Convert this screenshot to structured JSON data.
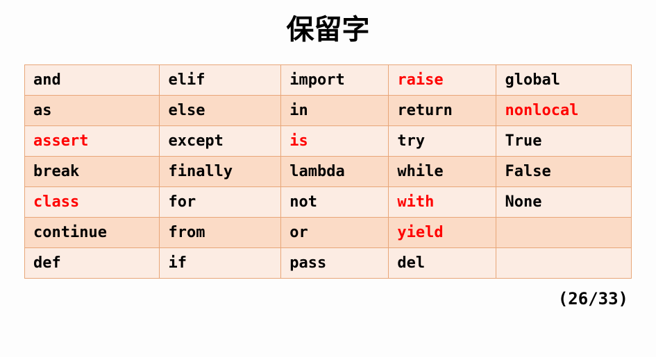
{
  "title": "保留字",
  "page_indicator": "(26/33)",
  "columns": 5,
  "table": {
    "rows": [
      [
        {
          "text": "and",
          "highlight": false
        },
        {
          "text": "elif",
          "highlight": false
        },
        {
          "text": "import",
          "highlight": false
        },
        {
          "text": "raise",
          "highlight": true
        },
        {
          "text": "global",
          "highlight": false
        }
      ],
      [
        {
          "text": "as",
          "highlight": false
        },
        {
          "text": "else",
          "highlight": false
        },
        {
          "text": "in",
          "highlight": false
        },
        {
          "text": "return",
          "highlight": false
        },
        {
          "text": "nonlocal",
          "highlight": true
        }
      ],
      [
        {
          "text": "assert",
          "highlight": true
        },
        {
          "text": "except",
          "highlight": false
        },
        {
          "text": "is",
          "highlight": true
        },
        {
          "text": "try",
          "highlight": false
        },
        {
          "text": "True",
          "highlight": false
        }
      ],
      [
        {
          "text": "break",
          "highlight": false
        },
        {
          "text": "finally",
          "highlight": false
        },
        {
          "text": "lambda",
          "highlight": false
        },
        {
          "text": "while",
          "highlight": false
        },
        {
          "text": "False",
          "highlight": false
        }
      ],
      [
        {
          "text": "class",
          "highlight": true
        },
        {
          "text": "for",
          "highlight": false
        },
        {
          "text": "not",
          "highlight": false
        },
        {
          "text": "with",
          "highlight": true
        },
        {
          "text": "None",
          "highlight": false
        }
      ],
      [
        {
          "text": "continue",
          "highlight": false
        },
        {
          "text": "from",
          "highlight": false
        },
        {
          "text": "or",
          "highlight": false
        },
        {
          "text": "yield",
          "highlight": true
        },
        {
          "text": "",
          "highlight": false
        }
      ],
      [
        {
          "text": "def",
          "highlight": false
        },
        {
          "text": "if",
          "highlight": false
        },
        {
          "text": "pass",
          "highlight": false
        },
        {
          "text": "del",
          "highlight": false
        },
        {
          "text": "",
          "highlight": false
        }
      ]
    ]
  }
}
